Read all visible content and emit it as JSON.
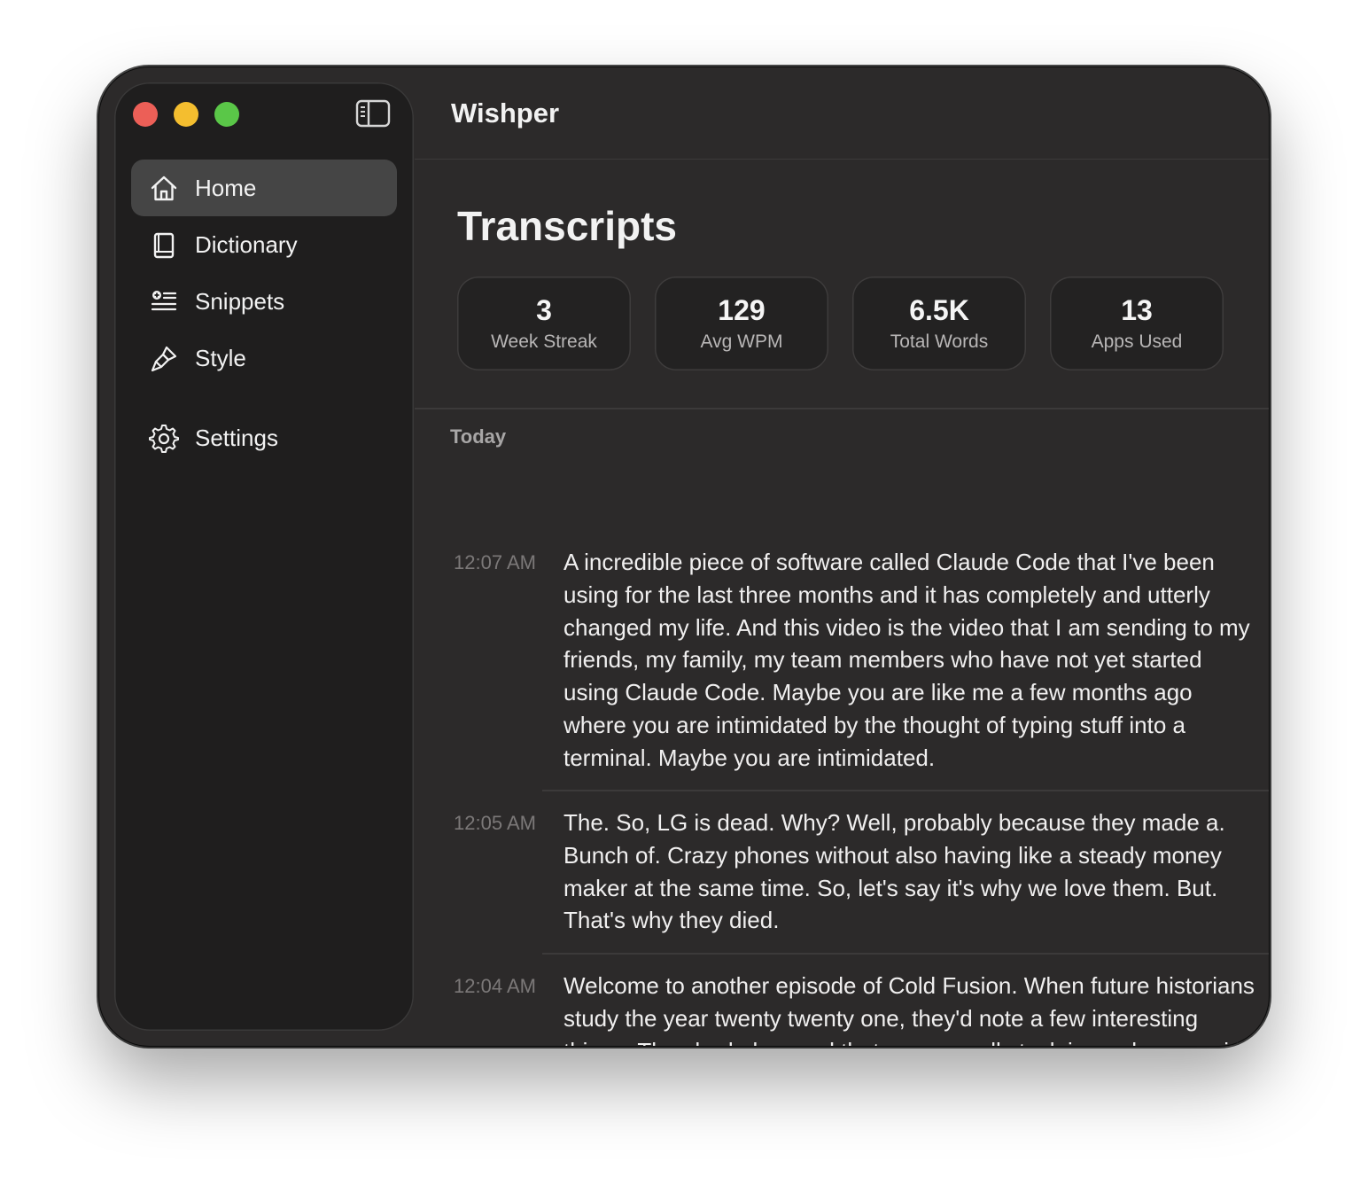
{
  "window": {
    "title": "Wishper"
  },
  "sidebar": {
    "items": [
      {
        "label": "Home",
        "icon": "home-icon",
        "active": true
      },
      {
        "label": "Dictionary",
        "icon": "book-icon",
        "active": false
      },
      {
        "label": "Snippets",
        "icon": "snippets-icon",
        "active": false
      },
      {
        "label": "Style",
        "icon": "brush-icon",
        "active": false
      },
      {
        "label": "Settings",
        "icon": "gear-icon",
        "active": false
      }
    ]
  },
  "main": {
    "section_title": "Transcripts",
    "stats": [
      {
        "value": "3",
        "label": "Week Streak"
      },
      {
        "value": "129",
        "label": "Avg WPM"
      },
      {
        "value": "6.5K",
        "label": "Total Words"
      },
      {
        "value": "13",
        "label": "Apps Used"
      }
    ],
    "groups": [
      {
        "label": "Today",
        "entries": [
          {
            "time": "12:07 AM",
            "text": "A incredible piece of software called Claude Code that I've been using for the last three months and it has completely and utterly changed my life. And this video is the video that I am sending to my friends, my family, my team members who have not yet started using Claude Code. Maybe you are like me a few months ago where you are intimidated by the thought of typing stuff into a terminal. Maybe you are intimidated."
          },
          {
            "time": "12:05 AM",
            "text": "The. So, LG is dead. Why? Well, probably because they made a. Bunch of. Crazy phones without also having like a steady money maker at the same time. So, let's say it's why we love them. But. That's why they died."
          },
          {
            "time": "12:04 AM",
            "text": "Welcome to another episode of Cold Fusion. When future historians study the year twenty twenty one, they'd note a few interesting things. They had observed that we were all stuck in our homes with nothing to do. Stimulus checks were raining from the sky, and speculation on financial assets were off the"
          }
        ]
      }
    ]
  },
  "colors": {
    "window_bg": "#2c2a2a",
    "sidebar_bg": "#1f1e1e",
    "active_item_bg": "#454545",
    "close": "#ec5f57",
    "minimize": "#f4be2f",
    "maximize": "#5ac748"
  }
}
